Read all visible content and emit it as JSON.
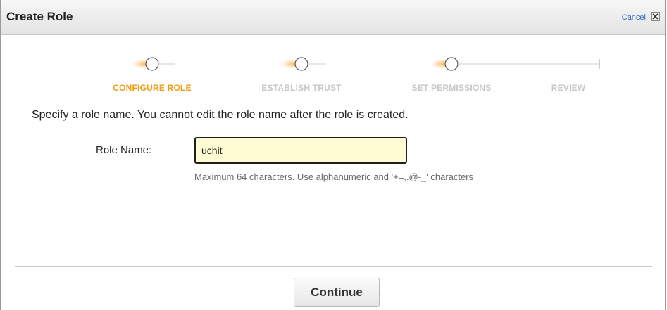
{
  "dialog": {
    "title": "Create Role",
    "cancel_label": "Cancel"
  },
  "steps": [
    {
      "label": "CONFIGURE ROLE",
      "state": "active"
    },
    {
      "label": "ESTABLISH TRUST",
      "state": "inactive"
    },
    {
      "label": "SET PERMISSIONS",
      "state": "inactive"
    },
    {
      "label": "REVIEW",
      "state": "inactive"
    }
  ],
  "form": {
    "instruction": "Specify a role name. You cannot edit the role name after the role is created.",
    "role_name_label": "Role Name:",
    "role_name_value": "uchit",
    "hint": "Maximum 64 characters. Use alphanumeric and '+=,.@-_' characters"
  },
  "footer": {
    "continue_label": "Continue"
  },
  "colors": {
    "accent": "#f39c12",
    "inactive_step": "#c7c7c7",
    "link": "#2e6bc0",
    "input_bg": "#fffbd3"
  }
}
